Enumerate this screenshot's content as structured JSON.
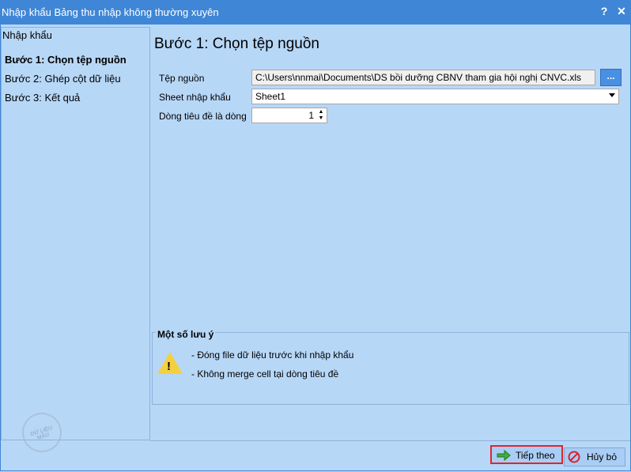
{
  "window": {
    "title": "Nhập khẩu Bảng thu nhập không thường xuyên",
    "help_label": "?",
    "close_label": "✕"
  },
  "sidebar": {
    "header": "Nhập khẩu",
    "steps": [
      {
        "label": "Bước 1: Chọn tệp nguồn",
        "active": true
      },
      {
        "label": "Bước 2: Ghép cột dữ liệu",
        "active": false
      },
      {
        "label": "Bước 3: Kết quả",
        "active": false
      }
    ],
    "watermark": "DỮ LIỆU MẪU"
  },
  "main": {
    "heading": "Bước 1: Chọn tệp nguồn",
    "source_file": {
      "label": "Tệp nguồn",
      "value": "C:\\Users\\nnmai\\Documents\\DS bồi dưỡng CBNV tham gia hội nghị CNVC.xls",
      "browse_label": "..."
    },
    "sheet": {
      "label": "Sheet nhập khẩu",
      "value": "Sheet1"
    },
    "header_row": {
      "label": "Dòng tiêu đề là dòng",
      "value": "1"
    }
  },
  "notes": {
    "title": "Một số lưu ý",
    "items": [
      "- Đóng file dữ liệu trước khi nhập khẩu",
      "- Không merge cell tại dòng tiêu đề"
    ]
  },
  "footer": {
    "next_label": "Tiếp theo",
    "cancel_label": "Hủy bỏ"
  },
  "colors": {
    "titlebar": "#3f86d6",
    "background": "#b7d7f7",
    "highlight_border": "#e0252b"
  }
}
